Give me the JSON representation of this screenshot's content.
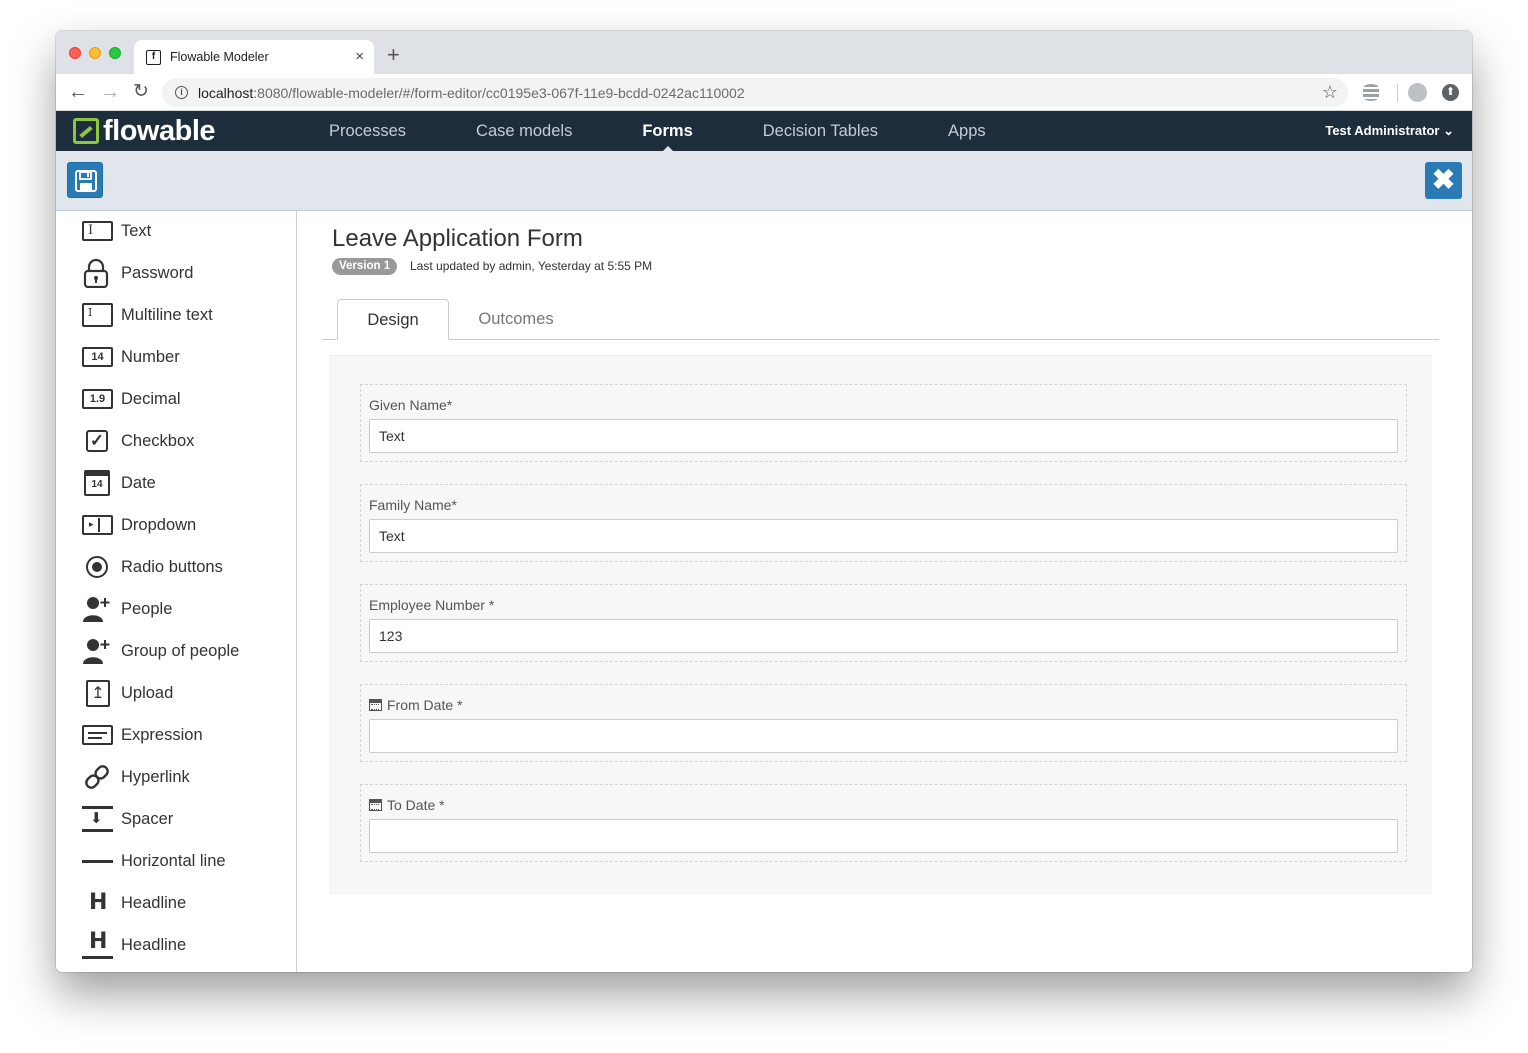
{
  "browser": {
    "tab_title": "Flowable Modeler",
    "tab_close": "×",
    "new_tab": "+",
    "url_host": "localhost",
    "url_rest": ":8080/flowable-modeler/#/form-editor/cc0195e3-067f-11e9-bcdd-0242ac110002",
    "icons": [
      "back-arrow-icon",
      "forward-arrow-icon",
      "reload-icon",
      "info-icon",
      "star-icon",
      "database-icon",
      "avatar-icon",
      "upload-icon"
    ]
  },
  "app": {
    "logo_text": "flowable",
    "nav": [
      {
        "label": "Processes",
        "active": false
      },
      {
        "label": "Case models",
        "active": false
      },
      {
        "label": "Forms",
        "active": true
      },
      {
        "label": "Decision Tables",
        "active": false
      },
      {
        "label": "Apps",
        "active": false
      }
    ],
    "user": "Test Administrator",
    "user_caret": "⌄",
    "accent": "#2a7ab5",
    "header_bg": "#1e2d3c",
    "logo_color": "#8dc63f"
  },
  "editor_toolbar": {
    "save_icon": "floppy-disk-icon",
    "close_icon": "close-icon",
    "close_glyph": "✖"
  },
  "palette": {
    "items": [
      {
        "label": "Text",
        "icon": "text-field-icon"
      },
      {
        "label": "Password",
        "icon": "lock-icon"
      },
      {
        "label": "Multiline text",
        "icon": "multiline-text-icon"
      },
      {
        "label": "Number",
        "icon": "number-icon",
        "glyph": "14"
      },
      {
        "label": "Decimal",
        "icon": "decimal-icon",
        "glyph": "1.9"
      },
      {
        "label": "Checkbox",
        "icon": "checkbox-icon",
        "glyph": "✓"
      },
      {
        "label": "Date",
        "icon": "calendar-icon",
        "glyph": "14"
      },
      {
        "label": "Dropdown",
        "icon": "dropdown-icon"
      },
      {
        "label": "Radio buttons",
        "icon": "radio-icon"
      },
      {
        "label": "People",
        "icon": "person-add-icon"
      },
      {
        "label": "Group of people",
        "icon": "group-add-icon"
      },
      {
        "label": "Upload",
        "icon": "upload-file-icon",
        "glyph": "↥"
      },
      {
        "label": "Expression",
        "icon": "expression-icon"
      },
      {
        "label": "Hyperlink",
        "icon": "link-icon",
        "glyph": "⛓"
      },
      {
        "label": "Spacer",
        "icon": "spacer-icon",
        "glyph": "⬇"
      },
      {
        "label": "Horizontal line",
        "icon": "horizontal-line-icon"
      },
      {
        "label": "Headline",
        "icon": "headline-icon",
        "glyph": "H"
      },
      {
        "label": "Headline",
        "icon": "headline-underlined-icon",
        "glyph": "H"
      }
    ]
  },
  "form": {
    "title": "Leave Application Form",
    "version": "Version 1",
    "last_updated": "Last updated by admin, Yesterday at 5:55 PM",
    "tabs": [
      {
        "label": "Design",
        "active": true
      },
      {
        "label": "Outcomes",
        "active": false
      }
    ],
    "fields": [
      {
        "label": "Given Name*",
        "value": "Text",
        "icon": null
      },
      {
        "label": "Family Name*",
        "value": "Text",
        "icon": null
      },
      {
        "label": "Employee Number *",
        "value": "123",
        "icon": null
      },
      {
        "label": "From Date *",
        "value": "",
        "icon": "calendar-icon"
      },
      {
        "label": "To Date *",
        "value": "",
        "icon": "calendar-icon"
      }
    ]
  }
}
